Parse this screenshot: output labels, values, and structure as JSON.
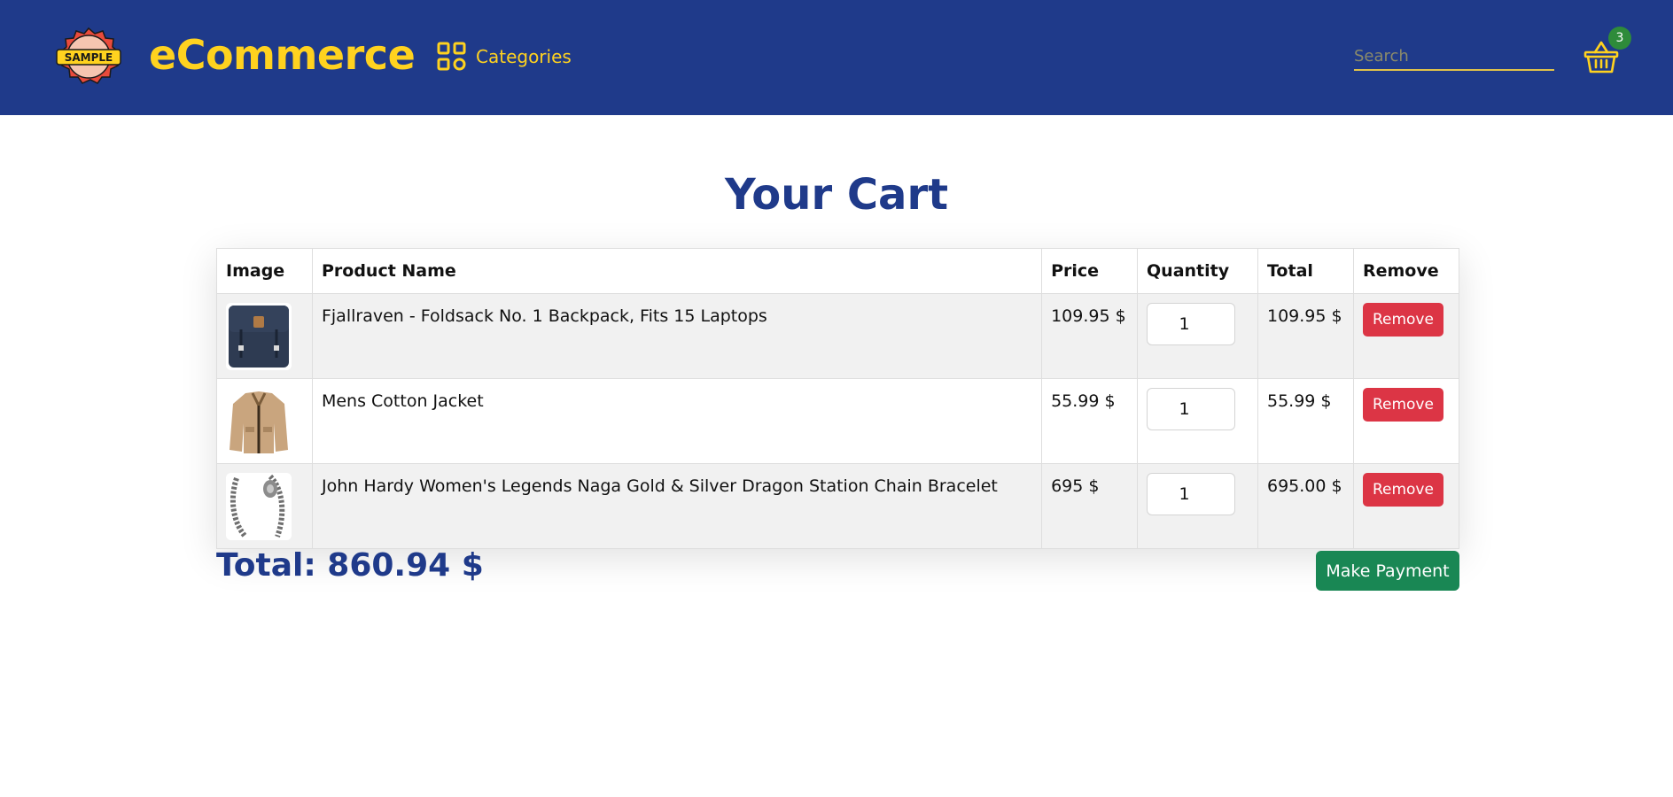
{
  "nav": {
    "logo_text": "SAMPLE",
    "brand": "eCommerce",
    "categories_label": "Categories",
    "search_placeholder": "Search",
    "cart_count": "3"
  },
  "cart": {
    "title": "Your Cart",
    "columns": [
      "Image",
      "Product Name",
      "Price",
      "Quantity",
      "Total",
      "Remove"
    ],
    "items": [
      {
        "name": "Fjallraven - Foldsack No. 1 Backpack, Fits 15 Laptops",
        "price": "109.95 $",
        "quantity": "1",
        "total": "109.95 $",
        "remove_label": "Remove",
        "image_icon": "backpack-image"
      },
      {
        "name": "Mens Cotton Jacket",
        "price": "55.99 $",
        "quantity": "1",
        "total": "55.99 $",
        "remove_label": "Remove",
        "image_icon": "jacket-image"
      },
      {
        "name": "John Hardy Women's Legends Naga Gold & Silver Dragon Station Chain Bracelet",
        "price": "695 $",
        "quantity": "1",
        "total": "695.00 $",
        "remove_label": "Remove",
        "image_icon": "bracelet-image"
      }
    ],
    "grand_total": "Total: 860.94 $",
    "pay_label": "Make Payment"
  },
  "colors": {
    "navbar": "#1f3a8a",
    "accent_yellow": "#ffd21f",
    "title_blue": "#1f3a8a",
    "remove_red": "#dc3545",
    "pay_green": "#198754",
    "badge_green": "#2e8b3a"
  }
}
